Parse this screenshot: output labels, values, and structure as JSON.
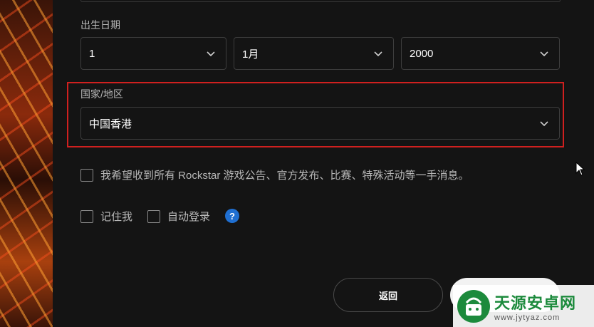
{
  "form": {
    "dob_label": "出生日期",
    "dob_day": "1",
    "dob_month": "1月",
    "dob_year": "2000",
    "country_label": "国家/地区",
    "country_value": "中国香港",
    "marketing_opt_in_label": "我希望收到所有 Rockstar 游戏公告、官方发布、比赛、特殊活动等一手消息。",
    "remember_me_label": "记住我",
    "auto_login_label": "自动登录",
    "help_symbol": "?",
    "back_label": "返回"
  },
  "watermark": {
    "title": "天源安卓网",
    "url": "www.jytyaz.com"
  },
  "colors": {
    "highlight": "#d0201f",
    "help_badge": "#1f6fd1",
    "watermark_green": "#1c8a3c"
  },
  "icons": [
    "chevron-down-icon",
    "help-icon",
    "mouse-cursor-icon",
    "watermark-logo-icon"
  ]
}
